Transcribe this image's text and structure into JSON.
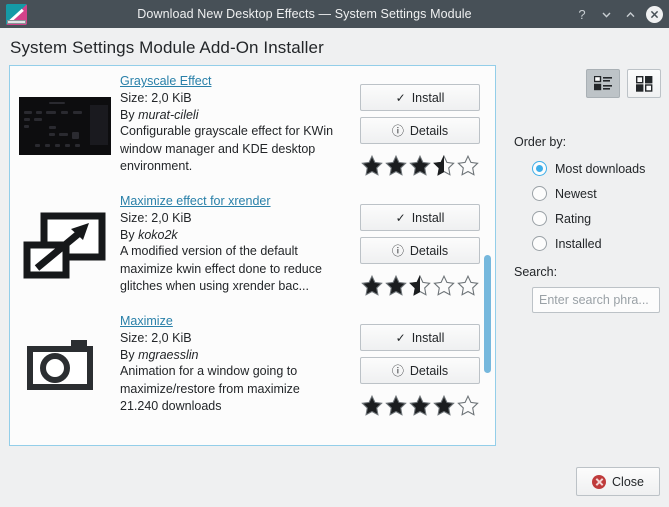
{
  "window": {
    "title": "Download New Desktop Effects — System Settings Module",
    "app_icon": "kde-settings-icon",
    "buttons": {
      "help": "?",
      "minimize": "minimize-chevron-down",
      "maximize": "maximize-chevron-up",
      "close": "close-x"
    }
  },
  "page": {
    "heading": "System Settings Module Add-On Installer"
  },
  "entries": [
    {
      "name": "Grayscale Effect",
      "size": "Size: 2,0 KiB",
      "by_prefix": "By ",
      "author": "murat-cileli",
      "summary": "Configurable grayscale effect for KWin window manager and KDE desktop environment.",
      "install_label": "Install",
      "details_label": "Details",
      "rating": 3.5,
      "thumbnail": "dark-screenshot-thumbnail"
    },
    {
      "name": "Maximize effect for xrender",
      "size": "Size: 2,0 KiB",
      "by_prefix": "By ",
      "author": "koko2k",
      "summary": "A modified version of the default maximize kwin effect done to reduce glitches when using xrender bac...",
      "install_label": "Install",
      "details_label": "Details",
      "rating": 2.5,
      "thumbnail": "maximize-window-arrow-icon"
    },
    {
      "name": "Maximize",
      "size": "Size: 2,0 KiB",
      "by_prefix": "By ",
      "author": "mgraesslin",
      "summary": "Animation for a window going to maximize/restore from maximize",
      "downloads": "21.240 downloads",
      "install_label": "Install",
      "details_label": "Details",
      "rating": 4,
      "thumbnail": "camera-placeholder-icon"
    }
  ],
  "sidebar": {
    "view_list_icon": "list-view-icon",
    "view_grid_icon": "grid-view-icon",
    "order_label": "Order by:",
    "order_options": [
      {
        "label": "Most downloads",
        "checked": true
      },
      {
        "label": "Newest",
        "checked": false
      },
      {
        "label": "Rating",
        "checked": false
      },
      {
        "label": "Installed",
        "checked": false
      }
    ],
    "search_label": "Search:",
    "search_placeholder": "Enter search phra...",
    "search_value": ""
  },
  "footer": {
    "close_label": "Close",
    "close_icon": "error-close-icon"
  },
  "colors": {
    "titlebar": "#475057",
    "accent": "#3daee9",
    "link": "#2980a9",
    "background": "#eff0f1",
    "panel": "#fcfcfc",
    "panel_border": "#93cee9",
    "scrollbar_thumb": "#76b8dd",
    "close_red": "#bf3b3b"
  }
}
